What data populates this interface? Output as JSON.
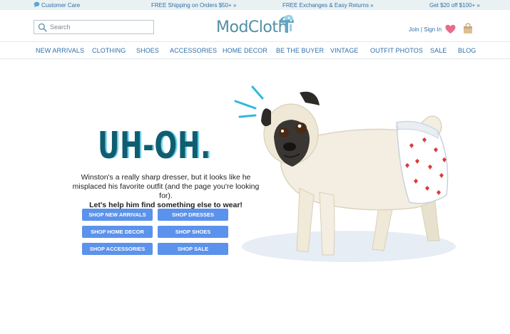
{
  "topbar": {
    "customer_care": "Customer Care",
    "free_shipping": "FREE Shipping on Orders $50+ »",
    "free_exchanges": "FREE Exchanges & Easy Returns »",
    "get_offer": "Get $20 off $100+ »"
  },
  "header": {
    "search_placeholder": "Search",
    "logo_text": "ModCloth",
    "join_signin": "Join | Sign In"
  },
  "nav": {
    "items": [
      "NEW ARRIVALS",
      "CLOTHING",
      "SHOES",
      "ACCESSORIES",
      "HOME DECOR",
      "BE THE BUYER",
      "VINTAGE",
      "OUTFIT PHOTOS",
      "SALE",
      "BLOG"
    ]
  },
  "hero": {
    "title": "UH-OH.",
    "message_line1": "Winston's a really sharp dresser, but it looks like he",
    "message_line2": "misplaced his favorite outfit (and the page you're looking for).",
    "message_bold": "Let's help him find something else to wear!",
    "buttons": [
      "SHOP NEW ARRIVALS",
      "SHOP DRESSES",
      "SHOP HOME DECOR",
      "SHOP SHOES",
      "SHOP ACCESSORIES",
      "SHOP SALE"
    ]
  },
  "colors": {
    "accent_blue": "#2f6fa8",
    "button_blue": "#5b92ec",
    "title_dark": "#0f5d70",
    "title_shadow": "#6fd0ea",
    "heart_pink": "#e86b8d"
  },
  "icons": {
    "customer_care": "chat-bubble-icon",
    "search": "magnifier-icon",
    "wishlist": "heart-icon",
    "cart": "shopping-bag-icon"
  }
}
